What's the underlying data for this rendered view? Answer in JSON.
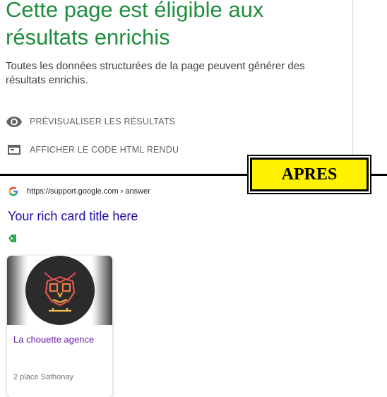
{
  "header": {
    "title": "Cette page est éligible aux résultats enrichis",
    "description": "Toutes les données structurées de la page peuvent générer des résultats enrichis.",
    "actions": [
      {
        "label": "PRÉVISUALISER LES RÉSULTATS",
        "icon": "eye-icon"
      },
      {
        "label": "AFFICHER LE CODE HTML RENDU",
        "icon": "code-window-icon"
      }
    ]
  },
  "banner": {
    "label": "APRES"
  },
  "result": {
    "url": "https://support.google.com › answer",
    "title": "Your rich card title here",
    "tag_icon": "green-tag-icon",
    "card": {
      "name": "La chouette agence",
      "address": "2 place Sathonay"
    }
  },
  "colors": {
    "title_green": "#1e8e3e",
    "link_blue": "#1a0dab",
    "card_purple": "#681da8",
    "banner_yellow": "#fff200"
  }
}
